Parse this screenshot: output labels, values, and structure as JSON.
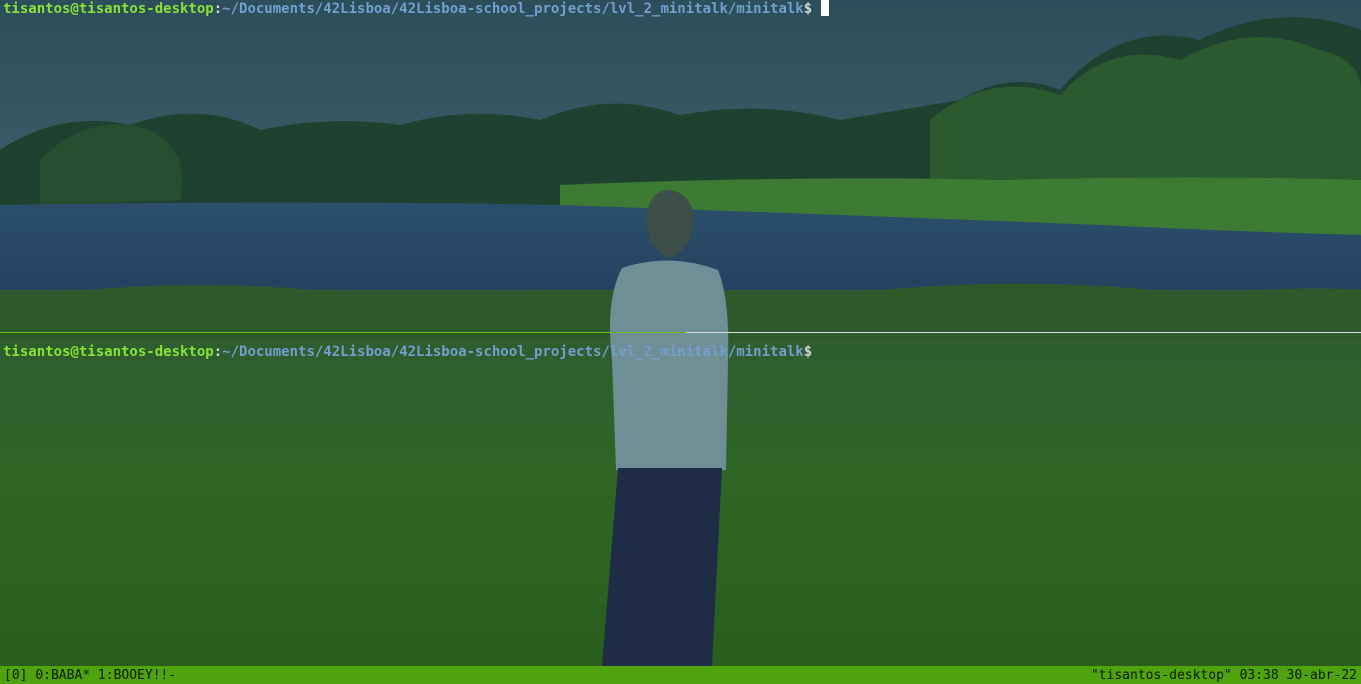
{
  "theme": {
    "prompt_user_color": "#8ae234",
    "prompt_path_color": "#729fcf",
    "status_bar_color": "#4fa30c",
    "active_border_color": "#6ac11e"
  },
  "wallpaper": {
    "description_icon": "landscape-photo"
  },
  "panes": [
    {
      "user_host": "tisantos@tisantos-desktop",
      "separator": ":",
      "path": "~/Documents/42Lisboa/42Lisboa-school_projects/lvl_2_minitalk/minitalk",
      "prompt_symbol": "$",
      "active": true
    },
    {
      "user_host": "tisantos@tisantos-desktop",
      "separator": ":",
      "path": "~/Documents/42Lisboa/42Lisboa-school_projects/lvl_2_minitalk/minitalk",
      "prompt_symbol": "$",
      "active": false
    }
  ],
  "statusbar": {
    "session": "[0]",
    "windows": "0:BABA* 1:BOOEY!!-",
    "host": "\"tisantos-desktop\"",
    "time": "03:38",
    "date": "30-abr-22"
  }
}
